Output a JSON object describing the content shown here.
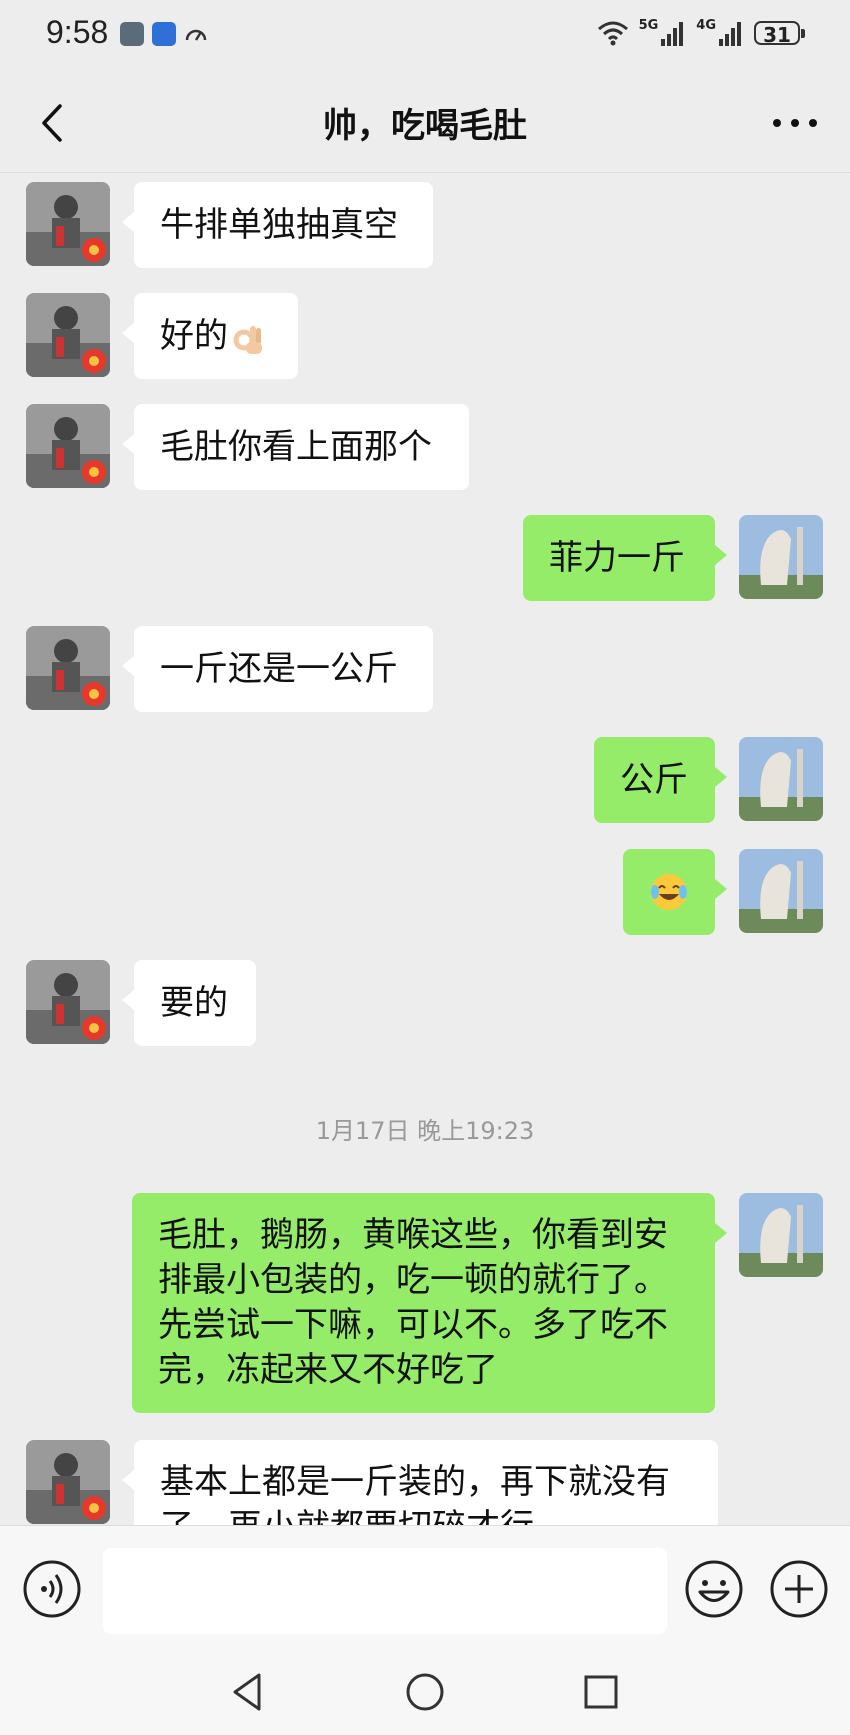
{
  "status_bar": {
    "time": "9:58",
    "signal_labels": [
      "5G",
      "4G"
    ],
    "battery": "31"
  },
  "header": {
    "title": "帅，吃喝毛肚"
  },
  "messages": [
    {
      "side": "left",
      "text": "牛排单独抽真空"
    },
    {
      "side": "left",
      "text": "好的",
      "emoji": "ok-hand-emoji"
    },
    {
      "side": "left",
      "text": "毛肚你看上面那个"
    },
    {
      "side": "right",
      "text": "菲力一斤"
    },
    {
      "side": "left",
      "text": "一斤还是一公斤"
    },
    {
      "side": "right",
      "text": "公斤"
    },
    {
      "side": "right",
      "text": "",
      "emoji": "laughing-crying-emoji"
    },
    {
      "side": "left",
      "text": "要的"
    },
    {
      "side": "right",
      "text": "毛肚，鹅肠，黄喉这些，你看到安排最小包装的，吃一顿的就行了。先尝试一下嘛，可以不。多了吃不完，冻起来又不好吃了"
    },
    {
      "side": "left",
      "text": "基本上都是一斤装的，再下就没有了，再小就都要切碎才行"
    }
  ],
  "timestamp": "1月17日 晚上19:23",
  "input": {
    "value": "",
    "placeholder": ""
  },
  "colors": {
    "background": "#ededed",
    "bubble_right": "#95ec69",
    "bubble_left": "#ffffff"
  }
}
